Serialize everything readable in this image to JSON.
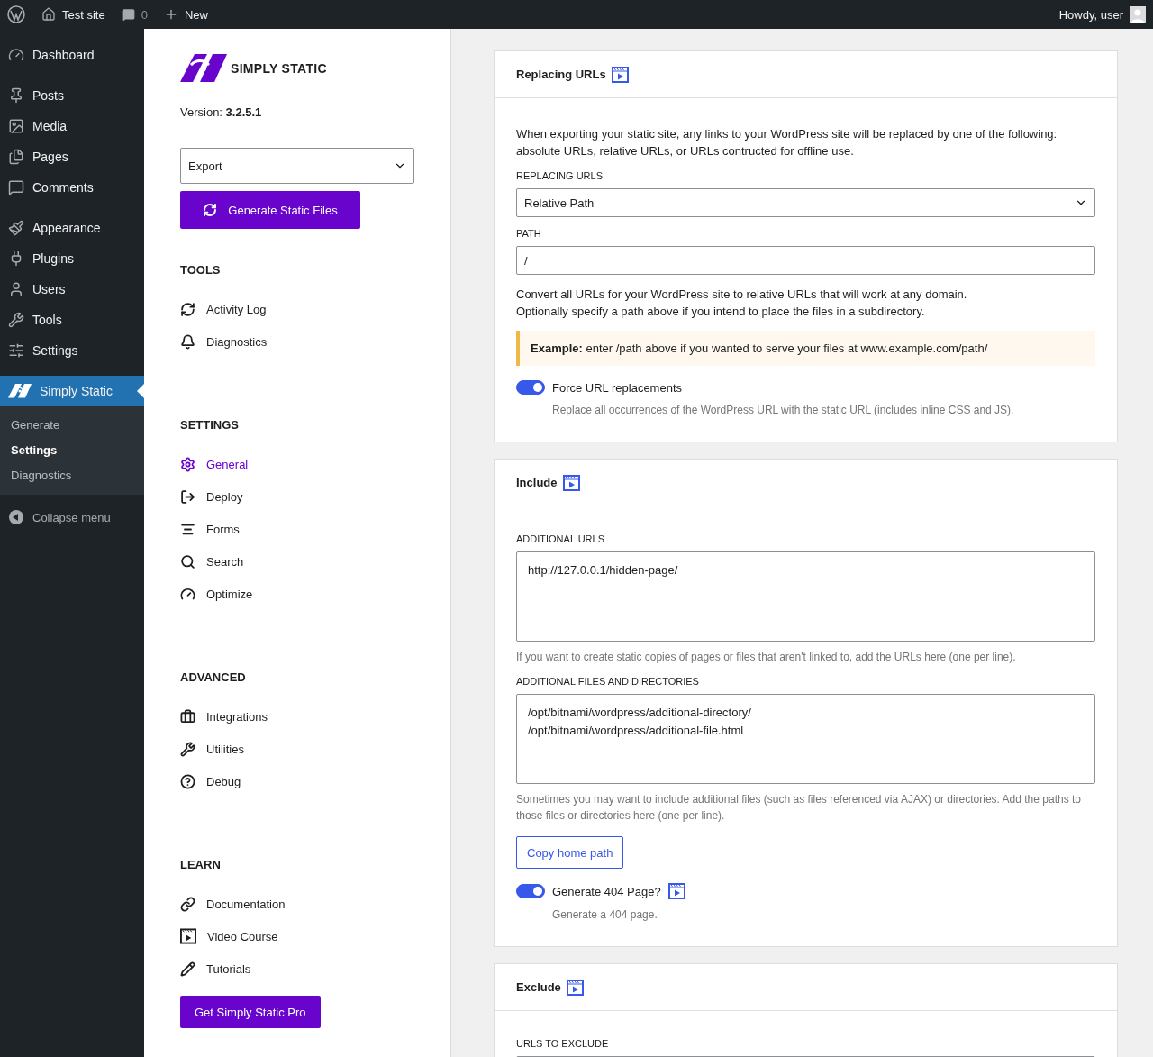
{
  "admin_bar": {
    "site": "Test site",
    "comments": "0",
    "new": "New",
    "greeting": "Howdy, user"
  },
  "admin_menu": {
    "groups": [
      [
        {
          "label": "Dashboard",
          "selected": false
        }
      ],
      [
        {
          "label": "Posts",
          "selected": false
        },
        {
          "label": "Media",
          "selected": false
        },
        {
          "label": "Pages",
          "selected": false
        },
        {
          "label": "Comments",
          "selected": false
        }
      ],
      [
        {
          "label": "Appearance",
          "selected": false
        },
        {
          "label": "Plugins",
          "selected": false
        },
        {
          "label": "Users",
          "selected": false
        },
        {
          "label": "Tools",
          "selected": false
        },
        {
          "label": "Settings",
          "selected": false
        }
      ],
      [
        {
          "label": "Simply Static",
          "selected": true
        }
      ]
    ],
    "submenu": [
      {
        "label": "Generate",
        "selected": false
      },
      {
        "label": "Settings",
        "selected": true
      },
      {
        "label": "Diagnostics",
        "selected": false
      }
    ],
    "collapse": "Collapse menu"
  },
  "plugin_sidebar": {
    "logo_text": "SIMPLY STATIC",
    "version": "Version: **3.2.5.1**",
    "export_select": "Export",
    "generate_button": "Generate Static Files",
    "sections": [
      {
        "title": "TOOLS",
        "items": [
          {
            "label": "Activity Log",
            "selected": false
          },
          {
            "label": "Diagnostics",
            "selected": false
          }
        ]
      },
      {
        "title": "SETTINGS",
        "items": [
          {
            "label": "General",
            "selected": true
          },
          {
            "label": "Deploy",
            "selected": false
          },
          {
            "label": "Forms",
            "selected": false
          },
          {
            "label": "Search",
            "selected": false
          },
          {
            "label": "Optimize",
            "selected": false
          }
        ]
      },
      {
        "title": "ADVANCED",
        "items": [
          {
            "label": "Integrations",
            "selected": false
          },
          {
            "label": "Utilities",
            "selected": false
          },
          {
            "label": "Debug",
            "selected": false
          }
        ]
      },
      {
        "title": "LEARN",
        "items": [
          {
            "label": "Documentation",
            "selected": false
          },
          {
            "label": "Video Course",
            "selected": false
          },
          {
            "label": "Tutorials",
            "selected": false
          }
        ]
      }
    ],
    "pro_button": "Get Simply Static Pro"
  },
  "cards": [
    {
      "title": "Replacing URLs",
      "blocks": [
        {
          "kind": "paragraph",
          "text": "When exporting your static site, any links to your WordPress site will be replaced by one of the following: absolute URLs, relative URLs, or URLs contructed for offline use."
        },
        {
          "kind": "select",
          "label": "REPLACING URLS",
          "value": "Relative Path"
        },
        {
          "kind": "input",
          "label": "PATH",
          "value": "/"
        },
        {
          "kind": "paragraph",
          "text": "Convert all URLs for your WordPress site to relative URLs that will work at any domain.\nOptionally specify a path above if you intend to place the files in a subdirectory."
        },
        {
          "kind": "notice",
          "text": "**Example:** enter /path above if you wanted to serve your files at www.example.com/path/"
        },
        {
          "kind": "toggle",
          "label": "Force URL replacements",
          "on": true,
          "video": false,
          "help": "Replace all occurrences of the WordPress URL with the static URL (includes inline CSS and JS)."
        }
      ]
    },
    {
      "title": "Include",
      "blocks": [
        {
          "kind": "textarea",
          "label": "ADDITIONAL URLS",
          "value": "http://127.0.0.1/hidden-page/",
          "help": "If you want to create static copies of pages or files that aren't linked to, add the URLs here (one per line)."
        },
        {
          "kind": "textarea",
          "label": "ADDITIONAL FILES AND DIRECTORIES",
          "value": "/opt/bitnami/wordpress/additional-directory/\n/opt/bitnami/wordpress/additional-file.html",
          "help": "Sometimes you may want to include additional files (such as files referenced via AJAX) or directories. Add the paths to those files or directories here (one per line)."
        },
        {
          "kind": "button",
          "label": "Copy home path"
        },
        {
          "kind": "toggle",
          "label": "Generate 404 Page?",
          "on": true,
          "video": true,
          "help": "Generate a 404 page."
        }
      ]
    },
    {
      "title": "Exclude",
      "blocks": [
        {
          "kind": "textarea",
          "label": "URLS TO EXCLUDE"
        }
      ]
    }
  ]
}
